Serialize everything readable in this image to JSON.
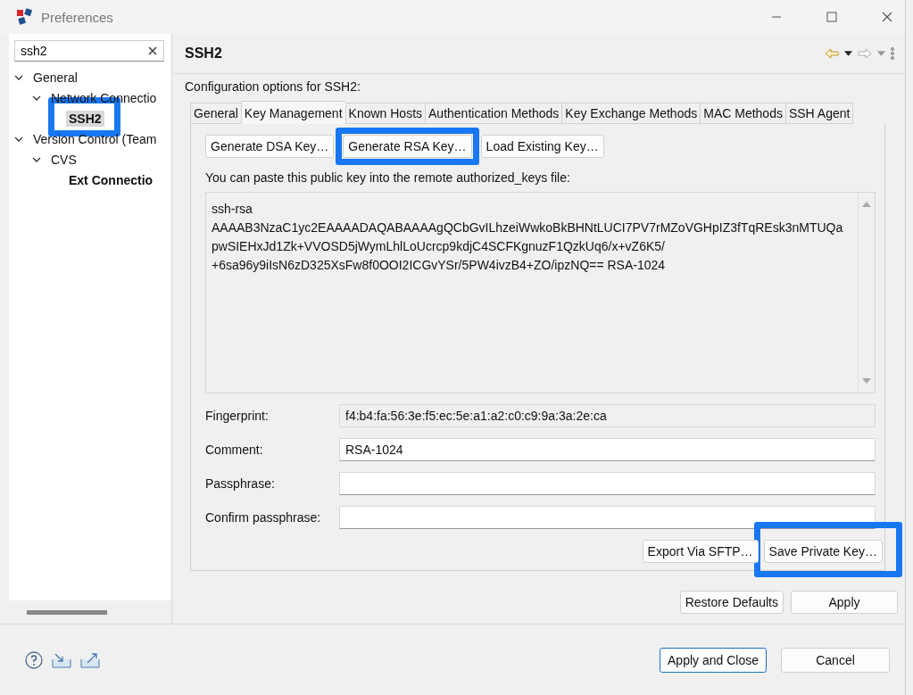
{
  "window": {
    "title": "Preferences"
  },
  "filter": {
    "value": "ssh2"
  },
  "tree": [
    {
      "label": "General",
      "expanded": true,
      "selected": false,
      "matched": false,
      "highlighted": false,
      "children": [
        {
          "label": "Network Connectio",
          "expanded": true,
          "selected": false,
          "matched": false,
          "highlighted": false,
          "children": [
            {
              "label": "SSH2",
              "selected": true,
              "matched": true,
              "highlighted": true
            }
          ]
        }
      ]
    },
    {
      "label": "Version Control (Team",
      "expanded": true,
      "selected": false,
      "matched": false,
      "highlighted": false,
      "children": [
        {
          "label": "CVS",
          "expanded": true,
          "selected": false,
          "matched": false,
          "highlighted": false,
          "children": [
            {
              "label": "Ext Connectio",
              "selected": false,
              "matched": true,
              "highlighted": false
            }
          ]
        }
      ]
    }
  ],
  "page": {
    "title": "SSH2",
    "description": "Configuration options for SSH2:",
    "tabs": [
      {
        "label": "General",
        "selected": false
      },
      {
        "label": "Key Management",
        "selected": true
      },
      {
        "label": "Known Hosts",
        "selected": false
      },
      {
        "label": "Authentication Methods",
        "selected": false
      },
      {
        "label": "Key Exchange Methods",
        "selected": false
      },
      {
        "label": "MAC Methods",
        "selected": false
      },
      {
        "label": "SSH Agent",
        "selected": false
      }
    ],
    "key_buttons": [
      {
        "label": "Generate DSA Key…",
        "highlighted": false
      },
      {
        "label": "Generate RSA Key…",
        "highlighted": true
      },
      {
        "label": "Load Existing Key…",
        "highlighted": false
      }
    ],
    "paste_hint": "You can paste this public key into the remote authorized_keys file:",
    "public_key": "ssh-rsa\nAAAAB3NzaC1yc2EAAAADAQABAAAAgQCbGvILhzeiWwkoBkBHNtLUCI7PV7rMZoVGHpIZ3fTqREsk3nMTUQa\npwSIEHxJd1Zk+VVOSD5jWymLhlLoUcrcp9kdjC4SCFKgnuzF1QzkUq6/x+vZ6K5/\n+6sa96y9iIsN6zD325XsFw8f0OOI2ICGvYSr/5PW4ivzB4+ZO/ipzNQ== RSA-1024",
    "fields": [
      {
        "label": "Fingerprint:",
        "value": "f4:b4:fa:56:3e:f5:ec:5e:a1:a2:c0:c9:9a:3a:2e:ca",
        "readonly": true
      },
      {
        "label": "Comment:",
        "value": "RSA-1024",
        "readonly": false
      },
      {
        "label": "Passphrase:",
        "readonly": false
      },
      {
        "label": "Confirm passphrase:",
        "readonly": false
      }
    ],
    "action_buttons": [
      {
        "label": "Export Via SFTP…",
        "highlighted": false
      },
      {
        "label": "Save Private Key…",
        "highlighted": true
      }
    ],
    "page_buttons": [
      "Restore Defaults",
      "Apply"
    ]
  },
  "footer_buttons": [
    {
      "label": "Apply and Close",
      "default": true
    },
    {
      "label": "Cancel",
      "default": false
    }
  ]
}
